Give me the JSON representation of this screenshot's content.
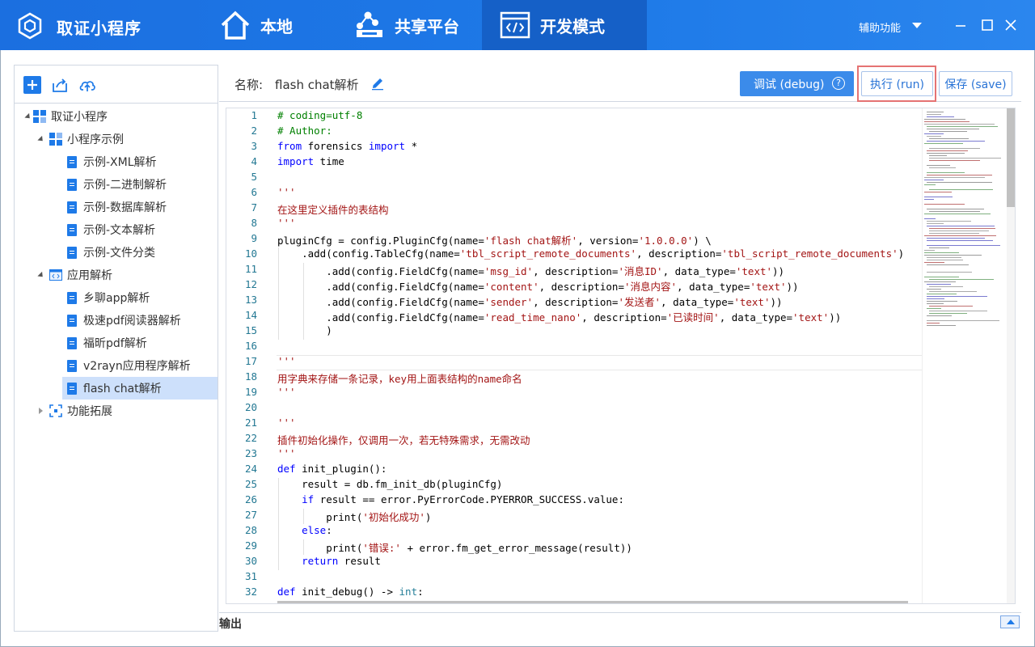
{
  "app": {
    "title": "取证小程序"
  },
  "nav": [
    {
      "label": "本地"
    },
    {
      "label": "共享平台"
    },
    {
      "label": "开发模式"
    }
  ],
  "assist_label": "辅助功能",
  "sidebar": {
    "tree": [
      {
        "label": "取证小程序",
        "level": 0,
        "expanded": true
      },
      {
        "label": "小程序示例",
        "level": 1,
        "expanded": true
      },
      {
        "label": "示例-XML解析",
        "level": 2
      },
      {
        "label": "示例-二进制解析",
        "level": 2
      },
      {
        "label": "示例-数据库解析",
        "level": 2
      },
      {
        "label": "示例-文本解析",
        "level": 2
      },
      {
        "label": "示例-文件分类",
        "level": 2
      },
      {
        "label": "应用解析",
        "level": 1,
        "expanded": true
      },
      {
        "label": "乡聊app解析",
        "level": 2
      },
      {
        "label": "极速pdf阅读器解析",
        "level": 2
      },
      {
        "label": "福昕pdf解析",
        "level": 2
      },
      {
        "label": "v2rayn应用程序解析",
        "level": 2
      },
      {
        "label": "flash chat解析",
        "level": 2,
        "selected": true
      },
      {
        "label": "功能拓展",
        "level": 1,
        "expanded": false
      }
    ]
  },
  "header": {
    "name_label": "名称:",
    "name_value": "flash chat解析",
    "debug_label": "调试 (debug)",
    "run_label": "执行 (run)",
    "save_label": "保存 (save)"
  },
  "editor": {
    "line_numbers": [
      "1",
      "2",
      "3",
      "4",
      "5",
      "6",
      "7",
      "8",
      "9",
      "10",
      "11",
      "12",
      "13",
      "14",
      "15",
      "16",
      "17",
      "18",
      "19",
      "20",
      "21",
      "22",
      "23",
      "24",
      "25",
      "26",
      "27",
      "28",
      "29",
      "30",
      "31",
      "32"
    ]
  },
  "output": {
    "label": "输出"
  },
  "colors": {
    "accent": "#1e7ae8",
    "highlight_border": "#e57373",
    "selected_bg": "#cde0fb"
  }
}
